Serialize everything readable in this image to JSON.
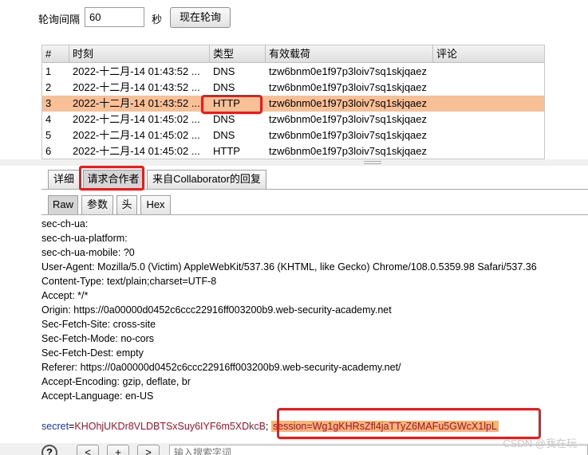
{
  "poll": {
    "label": "轮询间隔",
    "value": "60",
    "unit": "秒",
    "button": "现在轮询"
  },
  "table": {
    "columns": [
      "#",
      "时刻",
      "类型",
      "有效载荷",
      "评论"
    ],
    "rows": [
      {
        "n": "1",
        "time": "2022-十二月-14 01:43:52 ...",
        "type": "DNS",
        "payload": "tzw6bnm0e1f97p3loiv7sq1skjqaez",
        "comment": ""
      },
      {
        "n": "2",
        "time": "2022-十二月-14 01:43:52 ...",
        "type": "DNS",
        "payload": "tzw6bnm0e1f97p3loiv7sq1skjqaez",
        "comment": ""
      },
      {
        "n": "3",
        "time": "2022-十二月-14 01:43:52 ...",
        "type": "HTTP",
        "payload": "tzw6bnm0e1f97p3loiv7sq1skjqaez",
        "comment": ""
      },
      {
        "n": "4",
        "time": "2022-十二月-14 01:45:02 ...",
        "type": "DNS",
        "payload": "tzw6bnm0e1f97p3loiv7sq1skjqaez",
        "comment": ""
      },
      {
        "n": "5",
        "time": "2022-十二月-14 01:45:02 ...",
        "type": "DNS",
        "payload": "tzw6bnm0e1f97p3loiv7sq1skjqaez",
        "comment": ""
      },
      {
        "n": "6",
        "time": "2022-十二月-14 01:45:02 ...",
        "type": "HTTP",
        "payload": "tzw6bnm0e1f97p3loiv7sq1skjqaez",
        "comment": ""
      }
    ]
  },
  "detail_tabs": [
    "详细",
    "请求合作者",
    "来自Collaborator的回复"
  ],
  "view_tabs": [
    "Raw",
    "参数",
    "头",
    "Hex"
  ],
  "request_lines": [
    "sec-ch-ua:",
    "sec-ch-ua-platform:",
    "sec-ch-ua-mobile: ?0",
    "User-Agent: Mozilla/5.0 (Victim) AppleWebKit/537.36 (KHTML, like Gecko) Chrome/108.0.5359.98 Safari/537.36",
    "Content-Type: text/plain;charset=UTF-8",
    "Accept: */*",
    "Origin: https://0a00000d0452c6ccc22916ff003200b9.web-security-academy.net",
    "Sec-Fetch-Site: cross-site",
    "Sec-Fetch-Mode: no-cors",
    "Sec-Fetch-Dest: empty",
    "Referer: https://0a00000d0452c6ccc22916ff003200b9.web-security-academy.net/",
    "Accept-Encoding: gzip, deflate, br",
    "Accept-Language: en-US"
  ],
  "body": {
    "secret_key": "secret",
    "secret_eq": "=",
    "secret_value": "KHOhjUKDr8VLDBTSxSuy6IYF6m5XDkcB",
    "sep": "; ",
    "session": "session=Wg1gKHRsZfl4jaTTyZ6MAFu5GWcX1lpL"
  },
  "footer": {
    "help": "?",
    "nav": [
      "<",
      "+",
      ">"
    ],
    "search_placeholder": "输入搜索字词"
  },
  "watermark": "CSDN @我在玩"
}
